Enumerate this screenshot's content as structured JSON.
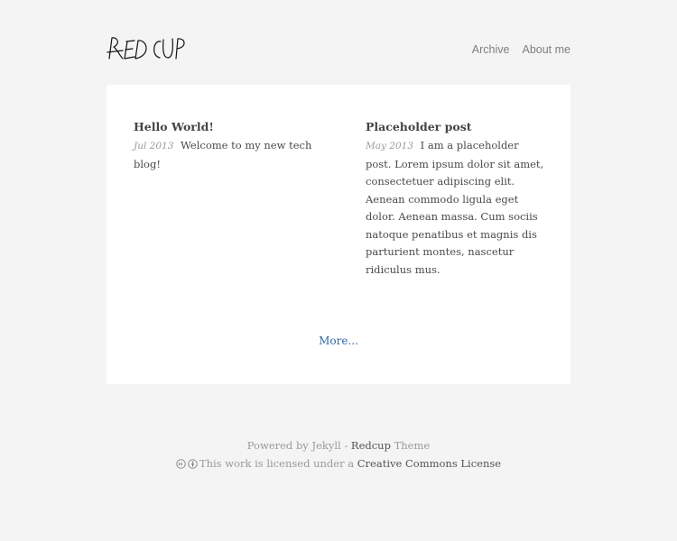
{
  "site": {
    "logo_text": "REDCUP"
  },
  "nav": {
    "archive_label": "Archive",
    "about_label": "About me"
  },
  "posts": [
    {
      "title": "Hello World!",
      "date": "Jul 2013",
      "excerpt": "Welcome to my new tech blog!"
    },
    {
      "title": "Placeholder post",
      "date": "May 2013",
      "excerpt": "I am a placeholder post. Lorem ipsum dolor sit amet, consectetuer adipiscing elit. Aenean commodo ligula eget dolor. Aenean massa. Cum sociis natoque penatibus et magnis dis parturient montes, nascetur ridiculus mus."
    }
  ],
  "more_label": "More...",
  "footer": {
    "powered_prefix": "Powered by Jekyll - ",
    "theme_link": "Redcup",
    "theme_suffix": " Theme",
    "license_prefix": "This work is licensed under a ",
    "license_link": "Creative Commons License",
    "icons": [
      "cc-icon",
      "by-icon"
    ]
  }
}
